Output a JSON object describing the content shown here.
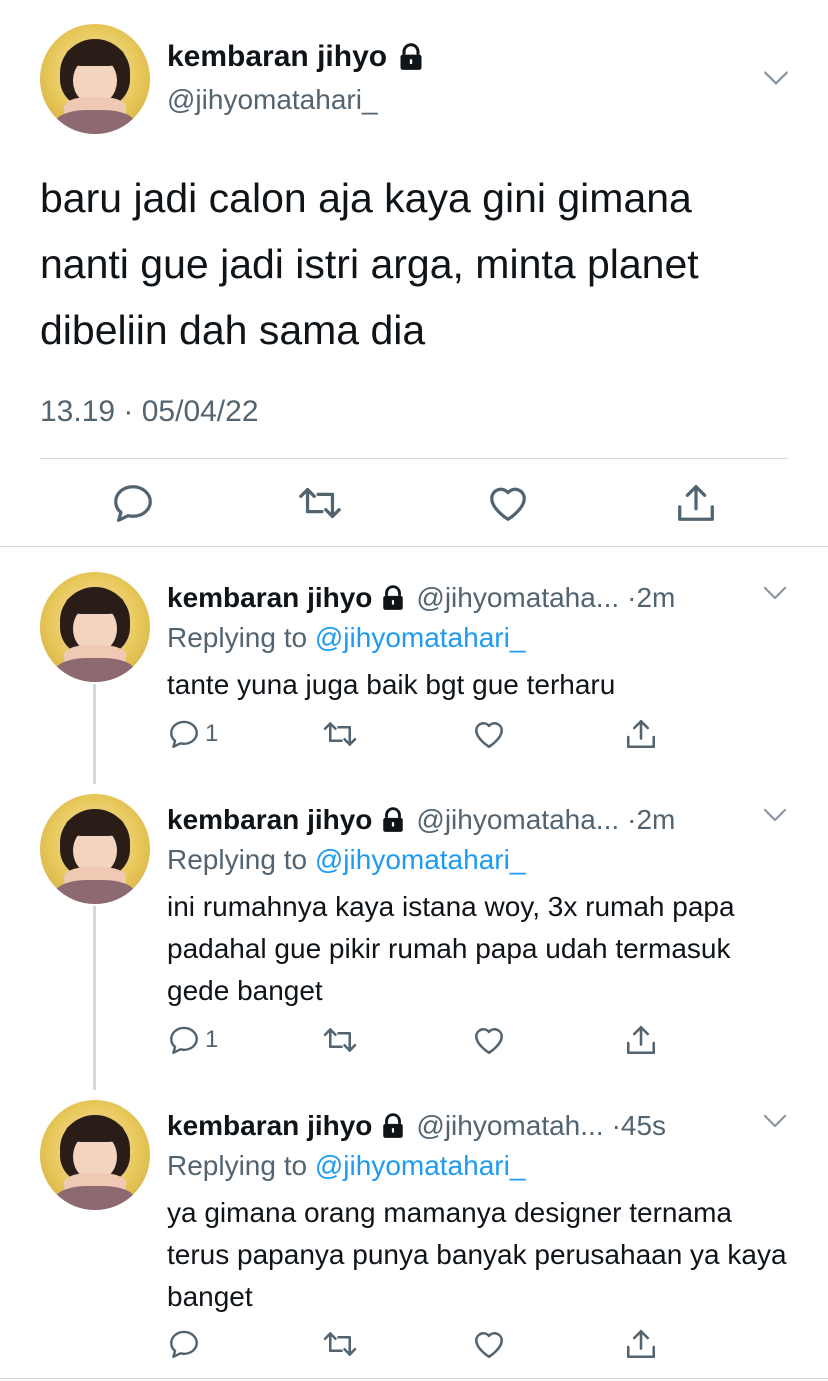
{
  "main": {
    "name": "kembaran jihyo",
    "handle": "@jihyomatahari_",
    "text": "baru jadi calon aja kaya gini gimana\nnanti gue jadi istri arga, minta planet\ndibeliin dah sama dia",
    "timestamp": "13.19 · 05/04/22"
  },
  "replies": [
    {
      "name": "kembaran jihyo",
      "handle": "@jihyomataha...",
      "time": "·2m",
      "replying_prefix": "Replying to ",
      "replying_to": "@jihyomatahari_",
      "text": "tante yuna juga baik bgt gue terharu",
      "reply_count": "1"
    },
    {
      "name": "kembaran jihyo",
      "handle": "@jihyomataha...",
      "time": "·2m",
      "replying_prefix": "Replying to ",
      "replying_to": "@jihyomatahari_",
      "text": "ini rumahnya kaya istana woy, 3x rumah papa padahal gue pikir rumah papa udah termasuk gede banget",
      "reply_count": "1"
    },
    {
      "name": "kembaran jihyo",
      "handle": "@jihyomatah...",
      "time": "·45s",
      "replying_prefix": "Replying to ",
      "replying_to": "@jihyomatahari_",
      "text": "ya gimana orang mamanya designer ternama terus papanya punya banyak perusahaan ya kaya banget",
      "reply_count": ""
    }
  ],
  "icons": {
    "lock": "lock-icon",
    "chevron": "chevron-down-icon",
    "reply": "reply-icon",
    "retweet": "retweet-icon",
    "like": "heart-icon",
    "share": "share-icon"
  },
  "colors": {
    "text": "#0f1419",
    "secondary": "#536471",
    "accent": "#1d9bf0",
    "divider": "#cfd9de"
  }
}
